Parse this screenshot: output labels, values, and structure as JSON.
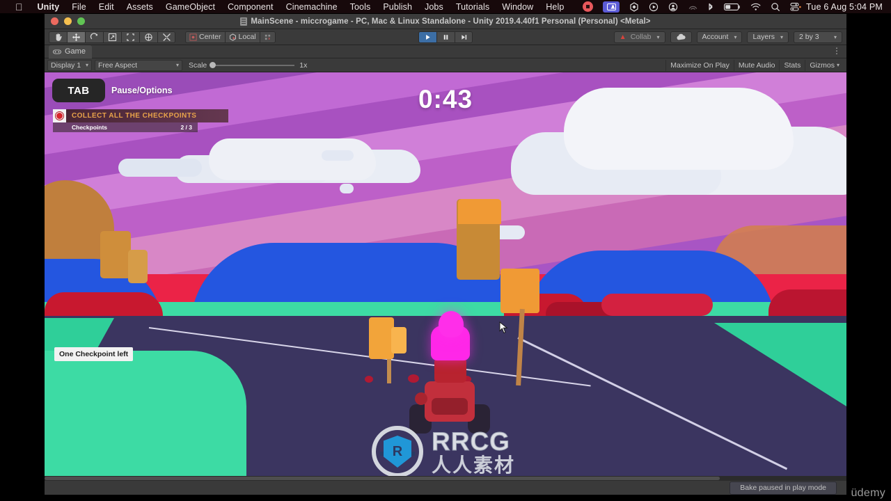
{
  "macbar": {
    "apple_icon": "apple-logo-icon",
    "items": [
      {
        "label": "Unity",
        "bold": true
      },
      {
        "label": "File",
        "bold": false
      },
      {
        "label": "Edit",
        "bold": false
      },
      {
        "label": "Assets",
        "bold": false
      },
      {
        "label": "GameObject",
        "bold": false
      },
      {
        "label": "Component",
        "bold": false
      },
      {
        "label": "Cinemachine",
        "bold": false
      },
      {
        "label": "Tools",
        "bold": false
      },
      {
        "label": "Publish",
        "bold": false
      },
      {
        "label": "Jobs",
        "bold": false
      },
      {
        "label": "Tutorials",
        "bold": false
      },
      {
        "label": "Window",
        "bold": false
      },
      {
        "label": "Help",
        "bold": false
      }
    ],
    "status_icons": [
      "screen-record-stop-icon",
      "screen-share-icon",
      "unity-hub-icon",
      "play-circle-icon",
      "user-circle-icon",
      "airplay-icon",
      "bluetooth-icon",
      "battery-icon",
      "wifi-icon",
      "search-icon",
      "control-center-icon"
    ],
    "clock": "Tue 6 Aug  5:04 PM"
  },
  "window": {
    "title": "MainScene - miccrogame - PC, Mac & Linux Standalone - Unity 2019.4.40f1 Personal (Personal) <Metal>",
    "title_icon": "scene-file-icon",
    "traffic": [
      "close-button",
      "minimize-button",
      "maximize-button"
    ]
  },
  "toolbar": {
    "transform_tools": [
      {
        "name": "hand-tool",
        "active": false
      },
      {
        "name": "move-tool",
        "active": true
      },
      {
        "name": "rotate-tool",
        "active": false
      },
      {
        "name": "scale-tool",
        "active": false
      },
      {
        "name": "rect-tool",
        "active": false
      },
      {
        "name": "transform-tool",
        "active": false
      },
      {
        "name": "custom-tool",
        "active": false
      }
    ],
    "pivot_label": "Center",
    "pivot_icon": "pivot-center-icon",
    "space_label": "Local",
    "space_icon": "local-space-icon",
    "collider_icon": "collider-toggle-icon",
    "play_controls": [
      {
        "name": "play-button",
        "icon": "play-icon",
        "active": true
      },
      {
        "name": "pause-button",
        "icon": "pause-icon",
        "active": false
      },
      {
        "name": "step-button",
        "icon": "step-icon",
        "active": false
      }
    ],
    "collab_label": "Collab",
    "collab_icon": "warning-triangle-icon",
    "cloud_icon": "cloud-icon",
    "account_label": "Account",
    "layers_label": "Layers",
    "layout_label": "2 by 3",
    "caret": "▾"
  },
  "game_panel": {
    "tab_label": "Game",
    "tab_icon": "game-view-icon",
    "kebab_icon": "panel-menu-icon",
    "display_label": "Display 1",
    "aspect_label": "Free Aspect",
    "scale_label": "Scale",
    "scale_value": "1x",
    "maximize_label": "Maximize On Play",
    "mute_label": "Mute Audio",
    "stats_label": "Stats",
    "gizmos_label": "Gizmos",
    "caret": "▾"
  },
  "hud": {
    "tab_key": "TAB",
    "pause_label": "Pause/Options",
    "timer": "0:43",
    "objective_title": "COLLECT ALL THE CHECKPOINTS",
    "objective_sub_label": "Checkpoints",
    "objective_count": "2 / 3",
    "objective_icon": "checkpoint-record-icon",
    "tooltip": "One Checkpoint left",
    "cursor_icon": "mouse-pointer-icon"
  },
  "watermark": {
    "brand": "RRCG",
    "brand_cn": "人人素材",
    "logo_glyph": "R",
    "udemy": "üdemy"
  },
  "status": {
    "bake_label": "Bake paused in play mode"
  },
  "colors": {
    "accent_play": "#3c6ea5",
    "objective_title": "#e8a34a",
    "sky_base": "#a855c4",
    "road": "#3b3560",
    "grass": "#3ddba4",
    "kart_body": "#c22f3c",
    "driver": "#ff27e8",
    "mac_bar": "#17090b",
    "unity_chrome": "#3a3a3a"
  }
}
